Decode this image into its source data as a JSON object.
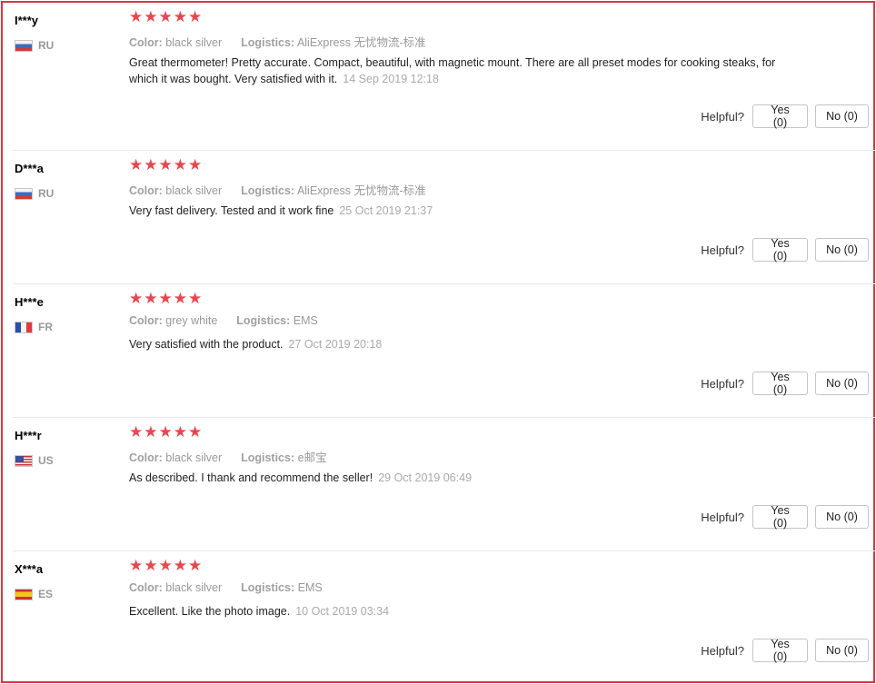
{
  "helpful_label": "Helpful?",
  "star_color": "#e8474d",
  "reviews": [
    {
      "user": "I***y",
      "country": "RU",
      "flag": "flag-ru",
      "stars": "★★★★★",
      "rating": 5,
      "color_label": "Color:",
      "color_value": "black silver",
      "logistics_label": "Logistics:",
      "logistics_value": "AliExpress 无忧物流-标准",
      "text": "Great thermometer! Pretty accurate. Compact, beautiful, with magnetic mount. There are all preset modes for cooking steaks, for which it was bought. Very satisfied with it.",
      "date": "14 Sep 2019 12:18",
      "yes_label": "Yes (0)",
      "no_label": "No (0)"
    },
    {
      "user": "D***a",
      "country": "RU",
      "flag": "flag-ru",
      "stars": "★★★★★",
      "rating": 5,
      "color_label": "Color:",
      "color_value": "black silver",
      "logistics_label": "Logistics:",
      "logistics_value": "AliExpress 无忧物流-标准",
      "text": "Very fast delivery. Tested and it work fine",
      "date": "25 Oct 2019 21:37",
      "yes_label": "Yes (0)",
      "no_label": "No (0)"
    },
    {
      "user": "H***e",
      "country": "FR",
      "flag": "flag-fr",
      "stars": "★★★★★",
      "rating": 5,
      "color_label": "Color:",
      "color_value": "grey white",
      "logistics_label": "Logistics:",
      "logistics_value": "EMS",
      "text": "Very satisfied with the product.",
      "date": "27 Oct 2019 20:18",
      "yes_label": "Yes (0)",
      "no_label": "No (0)"
    },
    {
      "user": "H***r",
      "country": "US",
      "flag": "flag-us",
      "stars": "★★★★★",
      "rating": 5,
      "color_label": "Color:",
      "color_value": "black silver",
      "logistics_label": "Logistics:",
      "logistics_value": "e邮宝",
      "text": "As described. I thank and recommend the seller!",
      "date": "29 Oct 2019 06:49",
      "yes_label": "Yes (0)",
      "no_label": "No (0)"
    },
    {
      "user": "X***a",
      "country": "ES",
      "flag": "flag-es",
      "stars": "★★★★★",
      "rating": 5,
      "color_label": "Color:",
      "color_value": "black silver",
      "logistics_label": "Logistics:",
      "logistics_value": "EMS",
      "text": "Excellent. Like the photo image.",
      "date": "10 Oct 2019 03:34",
      "yes_label": "Yes (0)",
      "no_label": "No (0)"
    }
  ]
}
